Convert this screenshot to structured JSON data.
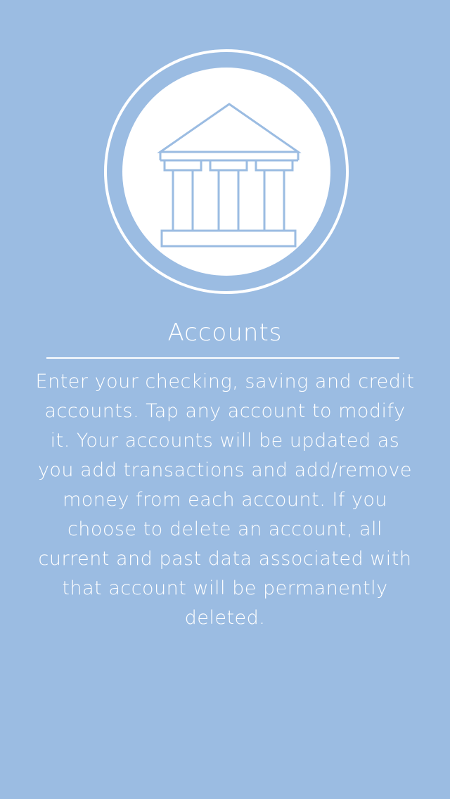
{
  "colors": {
    "background": "#9bbce2",
    "foreground": "#ffffff",
    "icon_stroke": "#9bbce2"
  },
  "hero": {
    "icon": "bank-icon"
  },
  "page": {
    "title": "Accounts",
    "description": "Enter your checking, saving and credit accounts. Tap any account to modify it. Your accounts will be updated as you add transactions and add/remove money from each account. If you choose to delete an account, all current and past data associated with that account will be permanently deleted."
  }
}
